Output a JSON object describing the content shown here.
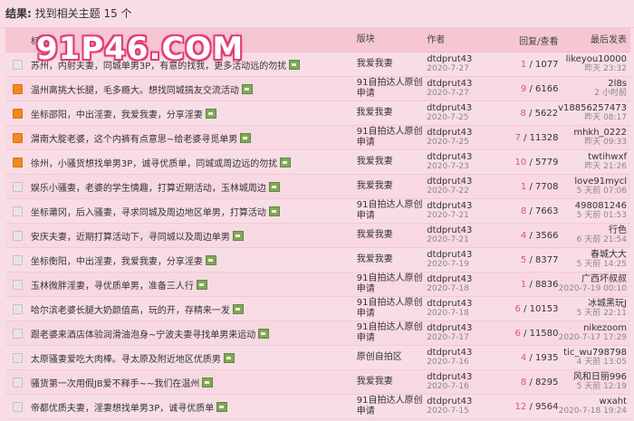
{
  "result": {
    "label": "结果:",
    "text": "找到相关主题 15 个"
  },
  "columns": {
    "title": "标题",
    "forum": "版块",
    "author": "作者",
    "stats": "回复/查看",
    "last": "最后发表"
  },
  "watermark": "91P46.COM",
  "rows": [
    {
      "icon": "normal",
      "title": "苏州，内射夫妻，同城单男3P，有意的找我，更多活动远的勿扰",
      "img": true,
      "forum": "我爱我妻",
      "author": "dtdprut43",
      "date": "2020-7-27",
      "replies": "1",
      "views": "1077",
      "last_user": "likeyou10000",
      "last_time": "昨天 23:32"
    },
    {
      "icon": "hot",
      "title": "温州离挑大长腿，毛多瘾大。想找同城搞友交流活动",
      "img": true,
      "forum": "91自拍达人原创申请",
      "author": "dtdprut43",
      "date": "2020-7-27",
      "replies": "9",
      "views": "6166",
      "last_user": "2l8s",
      "last_time": "2 小时前"
    },
    {
      "icon": "hot",
      "title": "坐标邵阳，中出淫妻，我爱我妻，分享淫妻",
      "img": true,
      "forum": "我爱我妻",
      "author": "dtdprut43",
      "date": "2020-7-25",
      "replies": "8",
      "views": "5622",
      "last_user": "v18856257473",
      "last_time": "昨天 08:17"
    },
    {
      "icon": "hot",
      "title": "渭南大腚老婆，这个内裤有点意思~给老婆寻觅单男",
      "img": true,
      "forum": "91自拍达人原创申请",
      "author": "dtdprut43",
      "date": "2020-7-25",
      "replies": "7",
      "views": "11328",
      "last_user": "mhkh_0222",
      "last_time": "昨天 09:33"
    },
    {
      "icon": "hot",
      "title": "徐州，小骚货想找单男3P，诚寻优质单，同城或周边远的勿扰",
      "img": true,
      "forum": "我爱我妻",
      "author": "dtdprut43",
      "date": "2020-7-23",
      "replies": "10",
      "views": "5779",
      "last_user": "twtihwxf",
      "last_time": "昨天 21:26"
    },
    {
      "icon": "normal",
      "title": "娱乐小骚妻，老婆的学生情趣，打算近期活动，玉林城周边",
      "img": true,
      "forum": "我爱我妻",
      "author": "dtdprut43",
      "date": "2020-7-22",
      "replies": "1",
      "views": "7708",
      "last_user": "love91mycl",
      "last_time": "5 天前 07:06"
    },
    {
      "icon": "normal",
      "title": "坐标莆冈，后入骚妻，寻求同城及周边地区单男，打算活动",
      "img": true,
      "forum": "91自拍达人原创申请",
      "author": "dtdprut43",
      "date": "2020-7-21",
      "replies": "8",
      "views": "7663",
      "last_user": "498081246",
      "last_time": "5 天前 01:53"
    },
    {
      "icon": "normal",
      "title": "安庆夫妻，近期打算活动下，寻同城以及周边单男",
      "img": true,
      "forum": "我爱我妻",
      "author": "dtdprut43",
      "date": "2020-7-21",
      "replies": "4",
      "views": "3566",
      "last_user": "行色",
      "last_time": "6 天前 21:54"
    },
    {
      "icon": "normal",
      "title": "坐标衡阳，中出淫妻，我爱我妻，分享淫妻",
      "img": true,
      "forum": "我爱我妻",
      "author": "dtdprut43",
      "date": "2020-7-19",
      "replies": "5",
      "views": "8377",
      "last_user": "春城大大",
      "last_time": "5 天前 14:25"
    },
    {
      "icon": "normal",
      "title": "玉林微胖淫妻，寻优质单男，准备三人行",
      "img": true,
      "forum": "91自拍达人原创申请",
      "author": "dtdprut43",
      "date": "2020-7-18",
      "replies": "1",
      "views": "8836",
      "last_user": "广西坏叔叔",
      "last_time": "2020-7-19 00:10"
    },
    {
      "icon": "normal",
      "title": "哈尔滨老婆长腿大奶颜值高，玩的开，存精来一发",
      "img": true,
      "forum": "91自拍达人原创申请",
      "author": "dtdprut43",
      "date": "2020-7-18",
      "replies": "6",
      "views": "10153",
      "last_user": "冰城黑玩J",
      "last_time": "5 天前 22:11"
    },
    {
      "icon": "normal",
      "title": "跟老婆来酒店体验润滑油泡身~宁波夫妻寻找单男来运动",
      "img": true,
      "forum": "91自拍达人原创申请",
      "author": "dtdprut43",
      "date": "2020-7-17",
      "replies": "6",
      "views": "11580",
      "last_user": "nikezoom",
      "last_time": "2020-7-17 17:29"
    },
    {
      "icon": "normal",
      "title": "太原骚妻爱吃大肉棒。寻太原及附近地区优质男",
      "img": true,
      "forum": "原创自拍区",
      "author": "dtdprut43",
      "date": "2020-7-16",
      "replies": "4",
      "views": "1935",
      "last_user": "tic_wu798798",
      "last_time": "4 天前 13:05"
    },
    {
      "icon": "normal",
      "title": "骚货第一次用假JB爱不释手~~我们在温州",
      "img": true,
      "forum": "我爱我妻",
      "author": "dtdprut43",
      "date": "2020-7-16",
      "replies": "8",
      "views": "8295",
      "last_user": "风和日丽996",
      "last_time": "5 天前 12:19"
    },
    {
      "icon": "normal",
      "title": "帝都优质夫妻，淫妻想找单男3P，诚寻优质单",
      "img": true,
      "forum": "91自拍达人原创申请",
      "author": "dtdprut43",
      "date": "2020-7-15",
      "replies": "12",
      "views": "9564",
      "last_user": "wxaht",
      "last_time": "2020-7-18 19:24"
    }
  ]
}
